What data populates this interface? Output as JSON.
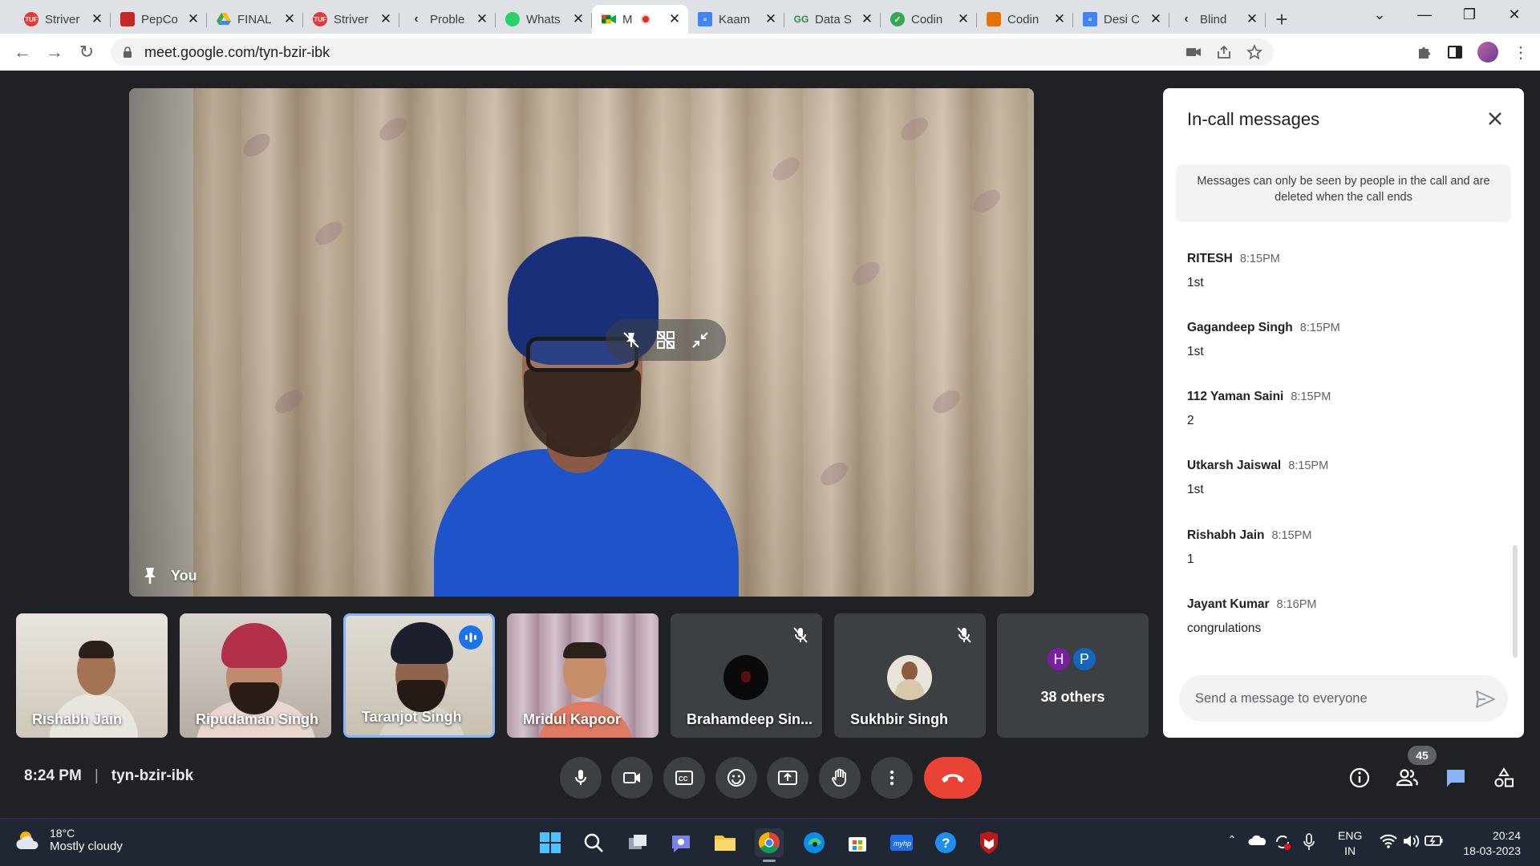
{
  "browser": {
    "tabs": [
      {
        "title": "Striver",
        "favicon_color": "#e53935",
        "favicon_text": "TUF"
      },
      {
        "title": "PepCo",
        "favicon_color": "#c62828",
        "favicon_text": ""
      },
      {
        "title": "FINAL",
        "favicon_color": "#34a853",
        "favicon_text": ""
      },
      {
        "title": "Striver",
        "favicon_color": "#e53935",
        "favicon_text": "TUF"
      },
      {
        "title": "Proble",
        "favicon_color": "#f2a900",
        "favicon_text": ""
      },
      {
        "title": "Whats",
        "favicon_color": "#25d366",
        "favicon_text": ""
      },
      {
        "title": "M",
        "favicon_color": "#00832d",
        "favicon_text": ""
      },
      {
        "title": "Kaam",
        "favicon_color": "#4285f4",
        "favicon_text": ""
      },
      {
        "title": "Data S",
        "favicon_color": "#2f8d46",
        "favicon_text": "GG"
      },
      {
        "title": "Codin",
        "favicon_color": "#34a853",
        "favicon_text": ""
      },
      {
        "title": "Codin",
        "favicon_color": "#e8710a",
        "favicon_text": ""
      },
      {
        "title": "Desi C",
        "favicon_color": "#4285f4",
        "favicon_text": ""
      },
      {
        "title": "Blind",
        "favicon_color": "#f2a900",
        "favicon_text": ""
      }
    ],
    "active_tab_index": 6,
    "url": "meet.google.com/tyn-bzir-ibk"
  },
  "main_video": {
    "label": "You"
  },
  "participants": [
    {
      "name": "Rishabh Jain",
      "video": true
    },
    {
      "name": "Ripudaman Singh",
      "video": true
    },
    {
      "name": "Taranjot Singh",
      "video": true,
      "speaking": true
    },
    {
      "name": "Mridul Kapoor",
      "video": true
    },
    {
      "name": "Brahamdeep Sin...",
      "video": false,
      "muted": true
    },
    {
      "name": "Sukhbir Singh",
      "video": false,
      "muted": true
    }
  ],
  "others": {
    "label": "38 others",
    "avatars": [
      {
        "letter": "H",
        "color": "#7b1fa2"
      },
      {
        "letter": "P",
        "color": "#1565c0"
      }
    ]
  },
  "chat": {
    "title": "In-call messages",
    "notice": "Messages can only be seen by people in the call and are deleted when the call ends",
    "messages": [
      {
        "sender": "RITESH",
        "time": "8:15PM",
        "text": "1st"
      },
      {
        "sender": "Gagandeep Singh",
        "time": "8:15PM",
        "text": "1st"
      },
      {
        "sender": "112 Yaman Saini",
        "time": "8:15PM",
        "text": "2"
      },
      {
        "sender": "Utkarsh Jaiswal",
        "time": "8:15PM",
        "text": "1st"
      },
      {
        "sender": "Rishabh Jain",
        "time": "8:15PM",
        "text": "1"
      },
      {
        "sender": "Jayant Kumar",
        "time": "8:16PM",
        "text": "congrulations"
      }
    ],
    "input_placeholder": "Send a message to everyone"
  },
  "meeting": {
    "time": "8:24 PM",
    "code": "tyn-bzir-ibk",
    "participant_count": "45"
  },
  "taskbar": {
    "weather_temp": "18°C",
    "weather_desc": "Mostly cloudy",
    "lang_1": "ENG",
    "lang_2": "IN",
    "time": "20:24",
    "date": "18-03-2023"
  }
}
